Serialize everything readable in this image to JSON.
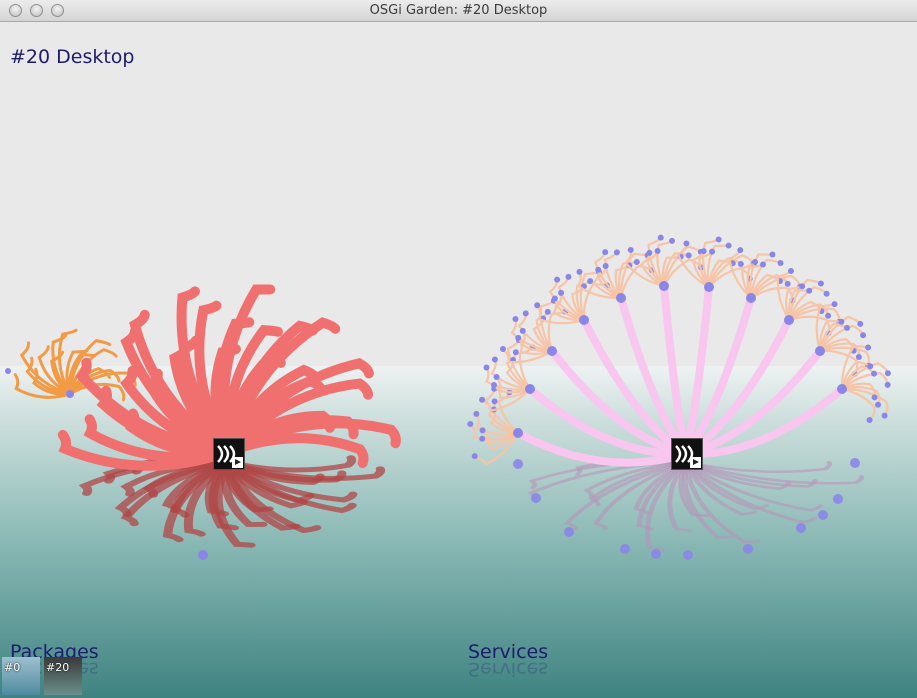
{
  "window": {
    "title": "OSGi Garden: #20 Desktop"
  },
  "header": {
    "title": "#20 Desktop"
  },
  "sections": {
    "packages": {
      "label": "Packages"
    },
    "services": {
      "label": "Services"
    }
  },
  "desktops": [
    {
      "label": "#0"
    },
    {
      "label": "#20"
    }
  ],
  "colors": {
    "heading": "#1d1d6e",
    "packages_anemone": "#f07070",
    "packages_small_anemone": "#f39a45",
    "services_stem": "#f8c6ee",
    "services_branches": "#f6c4a6",
    "node": "#8a86e8",
    "water_top": "#e0e9e8",
    "water_bottom": "#3f8381"
  },
  "icons": {
    "hub": "bundle-waves-icon",
    "traffic": [
      "close-button-icon",
      "minimize-button-icon",
      "zoom-button-icon"
    ]
  }
}
